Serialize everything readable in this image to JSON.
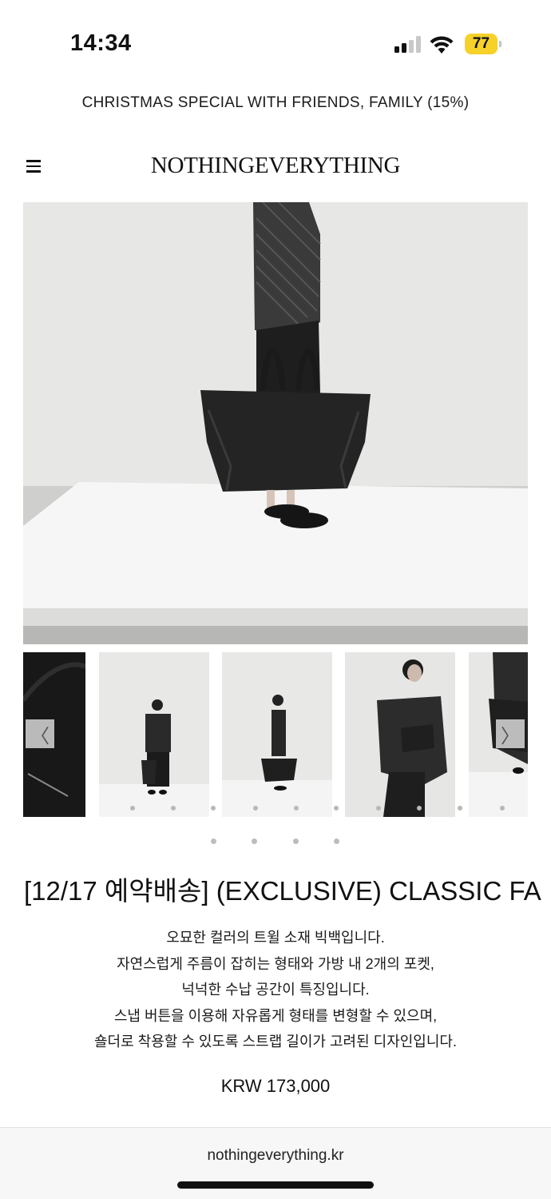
{
  "status_bar": {
    "time": "14:34",
    "battery": "77",
    "icons": [
      "signal-icon",
      "wifi-icon",
      "battery-icon"
    ],
    "battery_color": "#f5d12a"
  },
  "promo": {
    "text": "CHRISTMAS SPECIAL WITH FRIENDS, FAMILY (15%)"
  },
  "header": {
    "brand": "NOTHINGEVERYTHING",
    "menu_icon": "hamburger-menu-icon"
  },
  "gallery": {
    "prev_arrow": "〈",
    "next_arrow": "〉",
    "thumbnails": [
      "bag-detail",
      "model-front",
      "model-side",
      "model-holding-bag",
      "model-cropped"
    ]
  },
  "product": {
    "title": "[12/17 예약배송] (EXCLUSIVE) CLASSIC FA",
    "description": [
      "오묘한 컬러의 트윌 소재 빅백입니다.",
      "자연스럽게 주름이 잡히는 형태와 가방 내 2개의 포켓,",
      "넉넉한 수납 공간이 특징입니다.",
      "스냅 버튼을 이용해 자유롭게 형태를 변형할 수 있으며,",
      "숄더로 착용할 수 있도록 스트랩 길이가 고려된 디자인입니다."
    ],
    "price": "KRW 173,000"
  },
  "footer": {
    "url": "nothingeverything.kr"
  }
}
